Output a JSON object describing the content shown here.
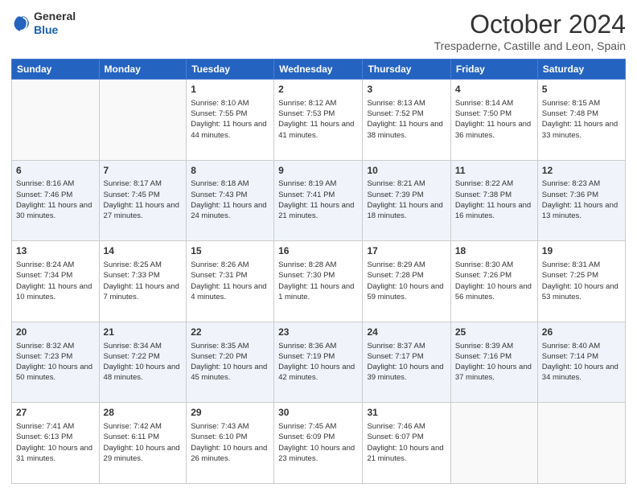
{
  "header": {
    "logo_line1": "General",
    "logo_line2": "Blue",
    "month": "October 2024",
    "location": "Trespaderne, Castille and Leon, Spain"
  },
  "days_of_week": [
    "Sunday",
    "Monday",
    "Tuesday",
    "Wednesday",
    "Thursday",
    "Friday",
    "Saturday"
  ],
  "weeks": [
    [
      {
        "day": "",
        "info": ""
      },
      {
        "day": "",
        "info": ""
      },
      {
        "day": "1",
        "info": "Sunrise: 8:10 AM\nSunset: 7:55 PM\nDaylight: 11 hours and 44 minutes."
      },
      {
        "day": "2",
        "info": "Sunrise: 8:12 AM\nSunset: 7:53 PM\nDaylight: 11 hours and 41 minutes."
      },
      {
        "day": "3",
        "info": "Sunrise: 8:13 AM\nSunset: 7:52 PM\nDaylight: 11 hours and 38 minutes."
      },
      {
        "day": "4",
        "info": "Sunrise: 8:14 AM\nSunset: 7:50 PM\nDaylight: 11 hours and 36 minutes."
      },
      {
        "day": "5",
        "info": "Sunrise: 8:15 AM\nSunset: 7:48 PM\nDaylight: 11 hours and 33 minutes."
      }
    ],
    [
      {
        "day": "6",
        "info": "Sunrise: 8:16 AM\nSunset: 7:46 PM\nDaylight: 11 hours and 30 minutes."
      },
      {
        "day": "7",
        "info": "Sunrise: 8:17 AM\nSunset: 7:45 PM\nDaylight: 11 hours and 27 minutes."
      },
      {
        "day": "8",
        "info": "Sunrise: 8:18 AM\nSunset: 7:43 PM\nDaylight: 11 hours and 24 minutes."
      },
      {
        "day": "9",
        "info": "Sunrise: 8:19 AM\nSunset: 7:41 PM\nDaylight: 11 hours and 21 minutes."
      },
      {
        "day": "10",
        "info": "Sunrise: 8:21 AM\nSunset: 7:39 PM\nDaylight: 11 hours and 18 minutes."
      },
      {
        "day": "11",
        "info": "Sunrise: 8:22 AM\nSunset: 7:38 PM\nDaylight: 11 hours and 16 minutes."
      },
      {
        "day": "12",
        "info": "Sunrise: 8:23 AM\nSunset: 7:36 PM\nDaylight: 11 hours and 13 minutes."
      }
    ],
    [
      {
        "day": "13",
        "info": "Sunrise: 8:24 AM\nSunset: 7:34 PM\nDaylight: 11 hours and 10 minutes."
      },
      {
        "day": "14",
        "info": "Sunrise: 8:25 AM\nSunset: 7:33 PM\nDaylight: 11 hours and 7 minutes."
      },
      {
        "day": "15",
        "info": "Sunrise: 8:26 AM\nSunset: 7:31 PM\nDaylight: 11 hours and 4 minutes."
      },
      {
        "day": "16",
        "info": "Sunrise: 8:28 AM\nSunset: 7:30 PM\nDaylight: 11 hours and 1 minute."
      },
      {
        "day": "17",
        "info": "Sunrise: 8:29 AM\nSunset: 7:28 PM\nDaylight: 10 hours and 59 minutes."
      },
      {
        "day": "18",
        "info": "Sunrise: 8:30 AM\nSunset: 7:26 PM\nDaylight: 10 hours and 56 minutes."
      },
      {
        "day": "19",
        "info": "Sunrise: 8:31 AM\nSunset: 7:25 PM\nDaylight: 10 hours and 53 minutes."
      }
    ],
    [
      {
        "day": "20",
        "info": "Sunrise: 8:32 AM\nSunset: 7:23 PM\nDaylight: 10 hours and 50 minutes."
      },
      {
        "day": "21",
        "info": "Sunrise: 8:34 AM\nSunset: 7:22 PM\nDaylight: 10 hours and 48 minutes."
      },
      {
        "day": "22",
        "info": "Sunrise: 8:35 AM\nSunset: 7:20 PM\nDaylight: 10 hours and 45 minutes."
      },
      {
        "day": "23",
        "info": "Sunrise: 8:36 AM\nSunset: 7:19 PM\nDaylight: 10 hours and 42 minutes."
      },
      {
        "day": "24",
        "info": "Sunrise: 8:37 AM\nSunset: 7:17 PM\nDaylight: 10 hours and 39 minutes."
      },
      {
        "day": "25",
        "info": "Sunrise: 8:39 AM\nSunset: 7:16 PM\nDaylight: 10 hours and 37 minutes."
      },
      {
        "day": "26",
        "info": "Sunrise: 8:40 AM\nSunset: 7:14 PM\nDaylight: 10 hours and 34 minutes."
      }
    ],
    [
      {
        "day": "27",
        "info": "Sunrise: 7:41 AM\nSunset: 6:13 PM\nDaylight: 10 hours and 31 minutes."
      },
      {
        "day": "28",
        "info": "Sunrise: 7:42 AM\nSunset: 6:11 PM\nDaylight: 10 hours and 29 minutes."
      },
      {
        "day": "29",
        "info": "Sunrise: 7:43 AM\nSunset: 6:10 PM\nDaylight: 10 hours and 26 minutes."
      },
      {
        "day": "30",
        "info": "Sunrise: 7:45 AM\nSunset: 6:09 PM\nDaylight: 10 hours and 23 minutes."
      },
      {
        "day": "31",
        "info": "Sunrise: 7:46 AM\nSunset: 6:07 PM\nDaylight: 10 hours and 21 minutes."
      },
      {
        "day": "",
        "info": ""
      },
      {
        "day": "",
        "info": ""
      }
    ]
  ]
}
